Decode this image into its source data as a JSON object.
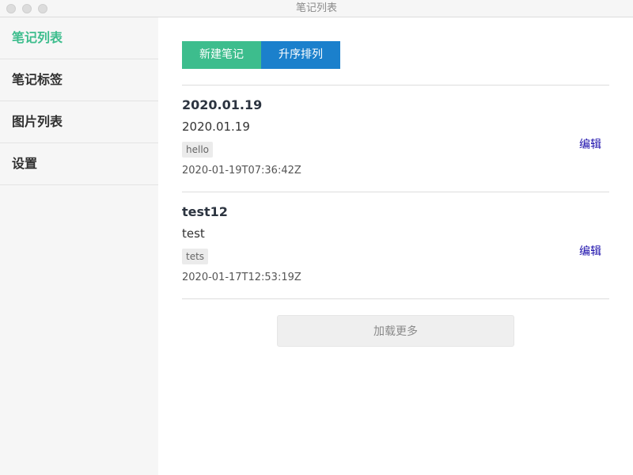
{
  "window": {
    "title": "笔记列表"
  },
  "sidebar": {
    "items": [
      {
        "label": "笔记列表",
        "active": true
      },
      {
        "label": "笔记标签"
      },
      {
        "label": "图片列表"
      },
      {
        "label": "设置"
      }
    ]
  },
  "toolbar": {
    "new_note_label": "新建笔记",
    "sort_label": "升序排列"
  },
  "notes": [
    {
      "title": "2020.01.19",
      "content": "2020.01.19",
      "tag": "hello",
      "time": "2020-01-19T07:36:42Z",
      "edit_label": "编辑"
    },
    {
      "title": "test12",
      "content": "test",
      "tag": "tets",
      "time": "2020-01-17T12:53:19Z",
      "edit_label": "编辑"
    }
  ],
  "load_more_label": "加载更多",
  "colors": {
    "accent_green": "#3dbd8d",
    "accent_blue": "#1b80cc",
    "link": "#1a0dab"
  }
}
